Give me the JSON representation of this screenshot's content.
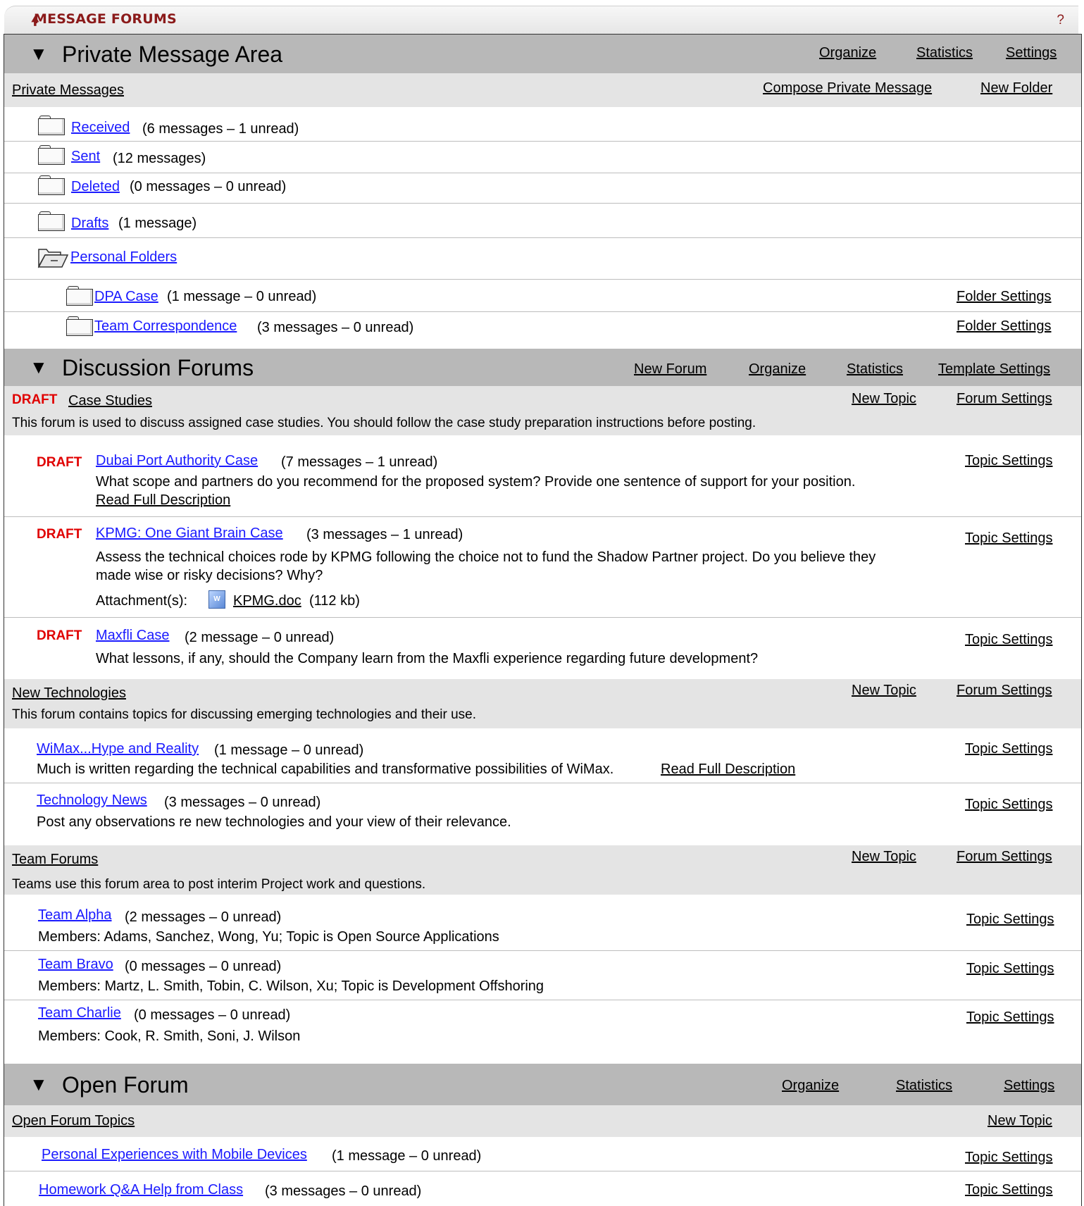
{
  "tabbar": {
    "title": "MESSAGE FORUMS",
    "help": "?"
  },
  "private": {
    "title": "Private Message Area",
    "actions": [
      "Organize",
      "Statistics",
      "Settings"
    ],
    "forum_title": "Private Messages",
    "forum_actions": [
      "Compose Private Message",
      "New Folder"
    ],
    "folders": [
      {
        "name": "Received",
        "count": "(6 messages – 1 unread)"
      },
      {
        "name": "Sent",
        "count": "(12 messages)"
      },
      {
        "name": "Deleted",
        "count": "(0 messages – 0 unread)"
      },
      {
        "name": "Drafts",
        "count": "(1 message)"
      },
      {
        "name": "Personal Folders",
        "count": ""
      }
    ],
    "personal": [
      {
        "name": "DPA Case",
        "count": "(1 message – 0 unread)",
        "settings": "Folder Settings"
      },
      {
        "name": "Team Correspondence",
        "count": "(3 messages – 0 unread)",
        "settings": "Folder Settings"
      }
    ]
  },
  "discussion": {
    "title": "Discussion Forums",
    "actions": [
      "New Forum",
      "Organize",
      "Statistics",
      "Template Settings"
    ],
    "forums": [
      {
        "draft": "DRAFT",
        "title": "Case Studies",
        "actions": [
          "New Topic",
          "Forum Settings"
        ],
        "description": "This forum is used to discuss assigned case studies.  You should follow the case study preparation instructions before posting.",
        "topics": [
          {
            "draft": "DRAFT",
            "title": "Dubai Port Authority Case",
            "count": "(7 messages – 1 unread)",
            "settings": "Topic Settings",
            "desc": "What scope and partners do you recommend for the proposed system?  Provide one sentence of support for your position.",
            "more": "Read Full Description"
          },
          {
            "draft": "DRAFT",
            "title": "KPMG: One Giant Brain Case",
            "count": "(3 messages – 1 unread)",
            "settings": "Topic Settings",
            "desc": "Assess the technical choices rode by KPMG following the choice not to fund the Shadow Partner project.  Do you believe they",
            "desc2": "made wise or risky decisions?  Why?",
            "attach_label": "Attachment(s):",
            "attach_name": "KPMG.doc",
            "attach_size": "(112 kb)",
            "attach_icon": "word-doc-icon"
          },
          {
            "draft": "DRAFT",
            "title": "Maxfli Case",
            "count": "(2 message – 0 unread)",
            "settings": "Topic Settings",
            "desc": "What lessons, if any, should the Company learn from the Maxfli experience regarding future development?"
          }
        ]
      },
      {
        "title": "New Technologies",
        "actions": [
          "New Topic",
          "Forum Settings"
        ],
        "description": "This forum contains topics for discussing emerging technologies and their use.",
        "topics": [
          {
            "title": "WiMax...Hype and Reality",
            "count": "(1 message – 0 unread)",
            "settings": "Topic Settings",
            "desc": "Much is written regarding the technical capabilities and transformative possibilities of WiMax.",
            "more": "Read Full Description"
          },
          {
            "title": "Technology News",
            "count": "(3 messages – 0 unread)",
            "settings": "Topic Settings",
            "desc": "Post any observations re new technologies and your view of their relevance."
          }
        ]
      },
      {
        "title": "Team Forums",
        "actions": [
          "New Topic",
          "Forum Settings"
        ],
        "description": "Teams use this forum area to post interim Project work and questions.",
        "topics": [
          {
            "title": "Team Alpha",
            "count": "(2 messages – 0 unread)",
            "settings": "Topic Settings",
            "desc": "Members: Adams, Sanchez, Wong, Yu; Topic is Open Source Applications"
          },
          {
            "title": "Team Bravo",
            "count": "(0 messages – 0 unread)",
            "settings": "Topic Settings",
            "desc": "Members: Martz, L. Smith, Tobin, C. Wilson, Xu; Topic is Development Offshoring"
          },
          {
            "title": "Team Charlie",
            "count": "(0 messages – 0 unread)",
            "settings": "Topic Settings",
            "desc": "Members: Cook, R. Smith, Soni, J. Wilson"
          }
        ]
      }
    ]
  },
  "open": {
    "title": "Open Forum",
    "actions": [
      "Organize",
      "Statistics",
      "Settings"
    ],
    "forum_title": "Open Forum Topics",
    "forum_action": "New Topic",
    "topics": [
      {
        "title": "Personal Experiences with Mobile Devices",
        "count": "(1 message – 0 unread)",
        "settings": "Topic Settings"
      },
      {
        "title": "Homework Q&A Help from Class",
        "count": "(3 messages – 0 unread)",
        "settings": "Topic Settings"
      }
    ]
  }
}
